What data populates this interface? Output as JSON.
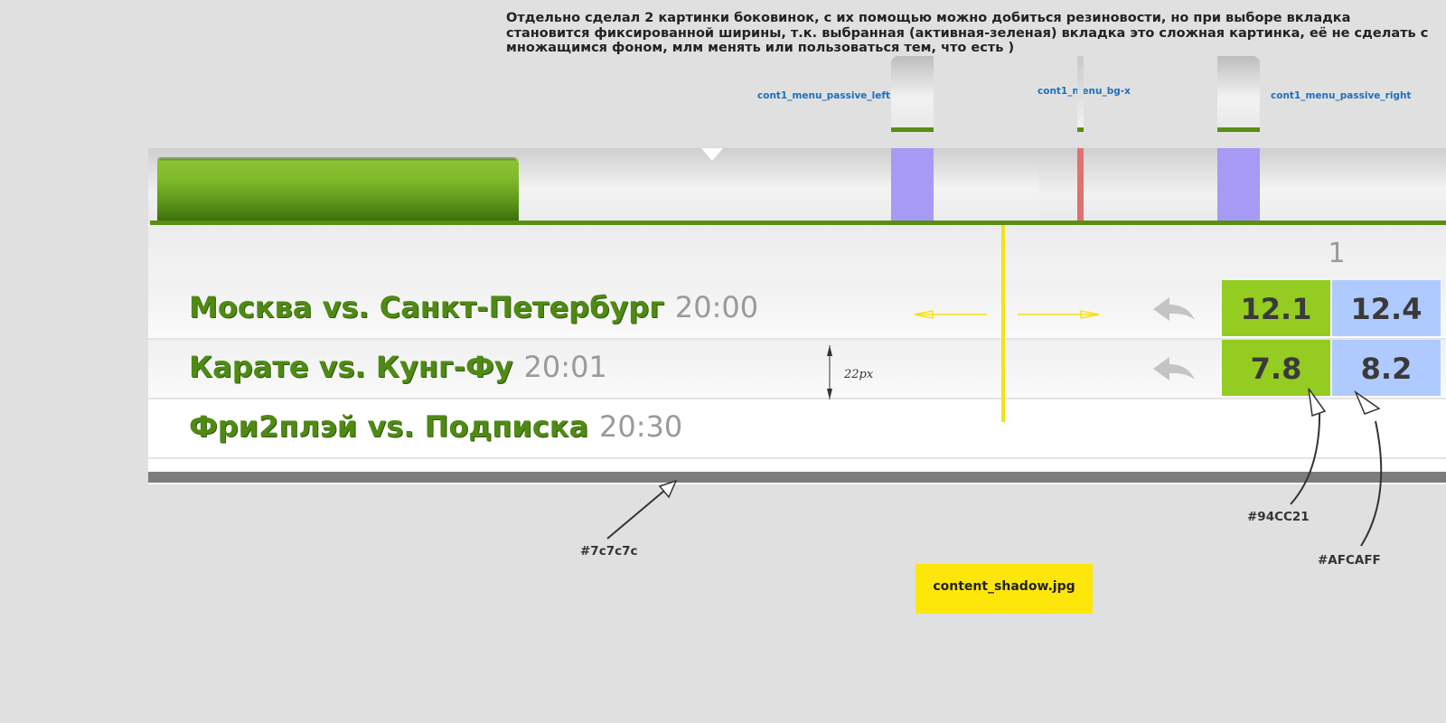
{
  "note": "Отдельно сделал 2 картинки боковинок, с их помощью можно добиться резиновости, но при выборе вкладка становится фиксированной ширины, т.к. выбранная (активная-зеленая) вкладка это сложная картинка, её не сделать с множащимся фоном, млм  менять или пользоваться тем, что есть )",
  "slice_labels": {
    "left": "cont1_menu_passive_left",
    "mid": "cont1_menu_bg-x",
    "right": "cont1_menu_passive_right"
  },
  "header_number": "1",
  "matches": [
    {
      "teams": "Москва vs. Санкт-Петербург",
      "time": "20:00",
      "odd_green": "12.1",
      "odd_blue": "12.4"
    },
    {
      "teams": "Карате vs. Кунг-Фу",
      "time": "20:01",
      "odd_green": "7.8",
      "odd_blue": "8.2"
    },
    {
      "teams": "Фри2плэй vs. Подписка",
      "time": "20:30"
    }
  ],
  "row_height_note": "22px",
  "annotations": {
    "shadow_color": "#7c7c7c",
    "green_color": "#94CC21",
    "blue_color": "#AFCAFF",
    "shadow_file": "content_shadow.jpg"
  }
}
